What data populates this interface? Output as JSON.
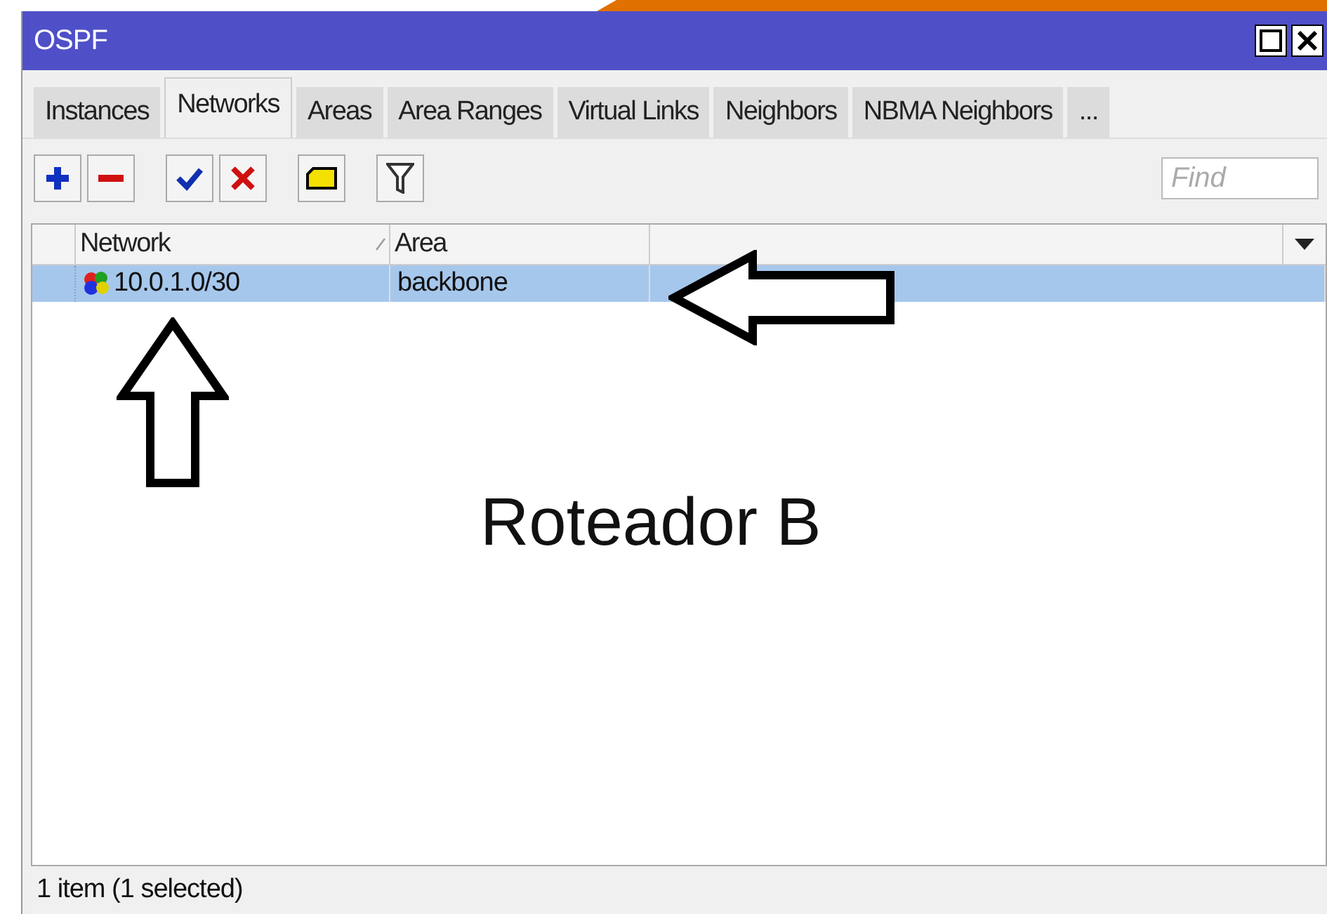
{
  "window": {
    "title": "OSPF"
  },
  "tabs": [
    {
      "label": "Instances",
      "selected": false
    },
    {
      "label": "Networks",
      "selected": true
    },
    {
      "label": "Areas",
      "selected": false
    },
    {
      "label": "Area Ranges",
      "selected": false
    },
    {
      "label": "Virtual Links",
      "selected": false
    },
    {
      "label": "Neighbors",
      "selected": false
    },
    {
      "label": "NBMA Neighbors",
      "selected": false
    },
    {
      "label": "...",
      "selected": false
    }
  ],
  "search": {
    "placeholder": "Find"
  },
  "table": {
    "columns": [
      "Network",
      "Area"
    ],
    "rows": [
      {
        "network": "10.0.1.0/30",
        "area": "backbone",
        "selected": true
      }
    ]
  },
  "annotation": {
    "label": "Roteador B"
  },
  "status_bar": "1 item (1 selected)"
}
